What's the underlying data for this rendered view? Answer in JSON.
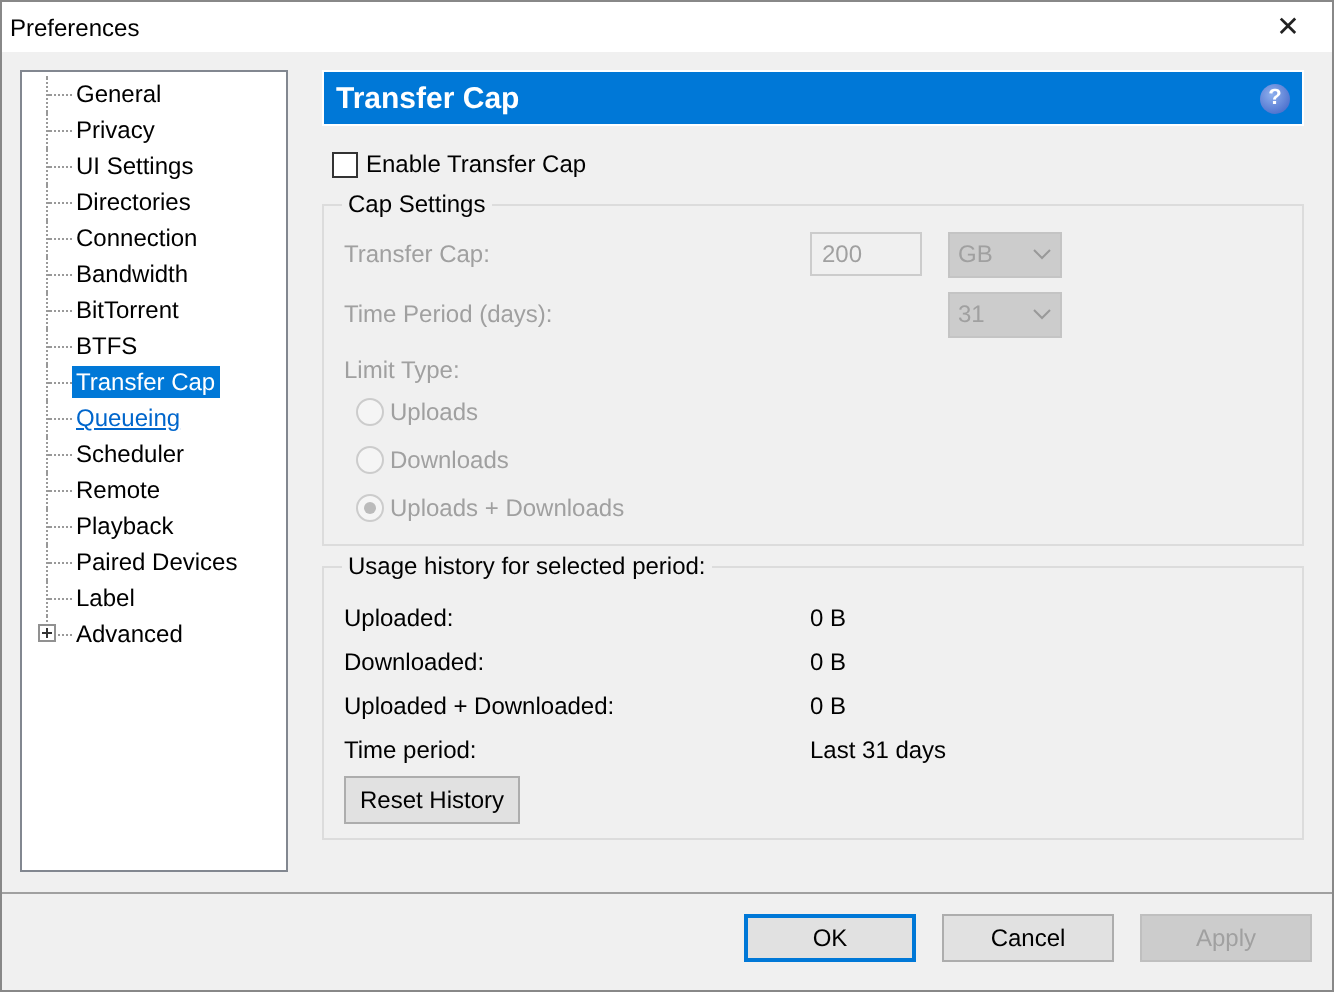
{
  "window": {
    "title": "Preferences",
    "close": "✕"
  },
  "tree": [
    {
      "label": "General",
      "kind": "leaf",
      "selected": false,
      "hovered": false
    },
    {
      "label": "Privacy",
      "kind": "leaf",
      "selected": false,
      "hovered": false
    },
    {
      "label": "UI Settings",
      "kind": "leaf",
      "selected": false,
      "hovered": false
    },
    {
      "label": "Directories",
      "kind": "leaf",
      "selected": false,
      "hovered": false
    },
    {
      "label": "Connection",
      "kind": "leaf",
      "selected": false,
      "hovered": false
    },
    {
      "label": "Bandwidth",
      "kind": "leaf",
      "selected": false,
      "hovered": false
    },
    {
      "label": "BitTorrent",
      "kind": "leaf",
      "selected": false,
      "hovered": false
    },
    {
      "label": "BTFS",
      "kind": "leaf",
      "selected": false,
      "hovered": false
    },
    {
      "label": "Transfer Cap",
      "kind": "leaf",
      "selected": true,
      "hovered": false
    },
    {
      "label": "Queueing",
      "kind": "leaf",
      "selected": false,
      "hovered": true
    },
    {
      "label": "Scheduler",
      "kind": "leaf",
      "selected": false,
      "hovered": false
    },
    {
      "label": "Remote",
      "kind": "leaf",
      "selected": false,
      "hovered": false
    },
    {
      "label": "Playback",
      "kind": "leaf",
      "selected": false,
      "hovered": false
    },
    {
      "label": "Paired Devices",
      "kind": "leaf",
      "selected": false,
      "hovered": false
    },
    {
      "label": "Label",
      "kind": "leaf",
      "selected": false,
      "hovered": false
    },
    {
      "label": "Advanced",
      "kind": "collapsed",
      "selected": false,
      "hovered": false
    }
  ],
  "header": {
    "title": "Transfer Cap",
    "help": "?"
  },
  "enable_checkbox": {
    "label": "Enable Transfer Cap",
    "checked": false
  },
  "cap_settings": {
    "title": "Cap Settings",
    "disabled": true,
    "transfer_cap": {
      "label": "Transfer Cap:",
      "value": "200",
      "unit": "GB"
    },
    "time_period": {
      "label": "Time Period (days):",
      "value": "31"
    },
    "limit_type": {
      "label": "Limit Type:",
      "options": [
        {
          "label": "Uploads",
          "selected": false
        },
        {
          "label": "Downloads",
          "selected": false
        },
        {
          "label": "Uploads + Downloads",
          "selected": true
        }
      ]
    }
  },
  "usage_history": {
    "title": "Usage history for selected period:",
    "rows": [
      {
        "label": "Uploaded:",
        "value": "0 B"
      },
      {
        "label": "Downloaded:",
        "value": "0 B"
      },
      {
        "label": "Uploaded + Downloaded:",
        "value": "0 B"
      },
      {
        "label": "Time period:",
        "value": "Last 31 days"
      }
    ],
    "reset_button": "Reset History"
  },
  "buttons": [
    {
      "label": "OK",
      "default": true,
      "disabled": false
    },
    {
      "label": "Cancel",
      "default": false,
      "disabled": false
    },
    {
      "label": "Apply",
      "default": false,
      "disabled": true
    }
  ]
}
